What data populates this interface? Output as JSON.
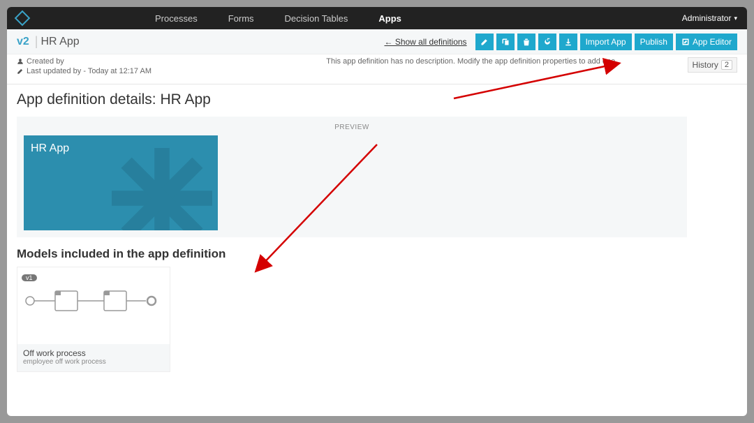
{
  "nav": {
    "processes": "Processes",
    "forms": "Forms",
    "decision_tables": "Decision Tables",
    "apps": "Apps"
  },
  "user": "Administrator",
  "subheader": {
    "version": "v2",
    "title": "HR App",
    "show_all": "← Show all definitions",
    "import": "Import App",
    "publish": "Publish",
    "editor": "App Editor"
  },
  "meta": {
    "created_by": "Created by",
    "last_updated": "Last updated by - Today at 12:17 AM",
    "description_placeholder": "This app definition has no description. Modify the app definition properties to add one",
    "history_label": "History",
    "history_count": "2"
  },
  "page": {
    "heading": "App definition details: HR App",
    "preview_label": "PREVIEW",
    "tile_title": "HR App",
    "models_heading": "Models included in the app definition"
  },
  "model": {
    "version_badge": "v1",
    "title": "Off work process",
    "subtitle": "employee off work process"
  }
}
